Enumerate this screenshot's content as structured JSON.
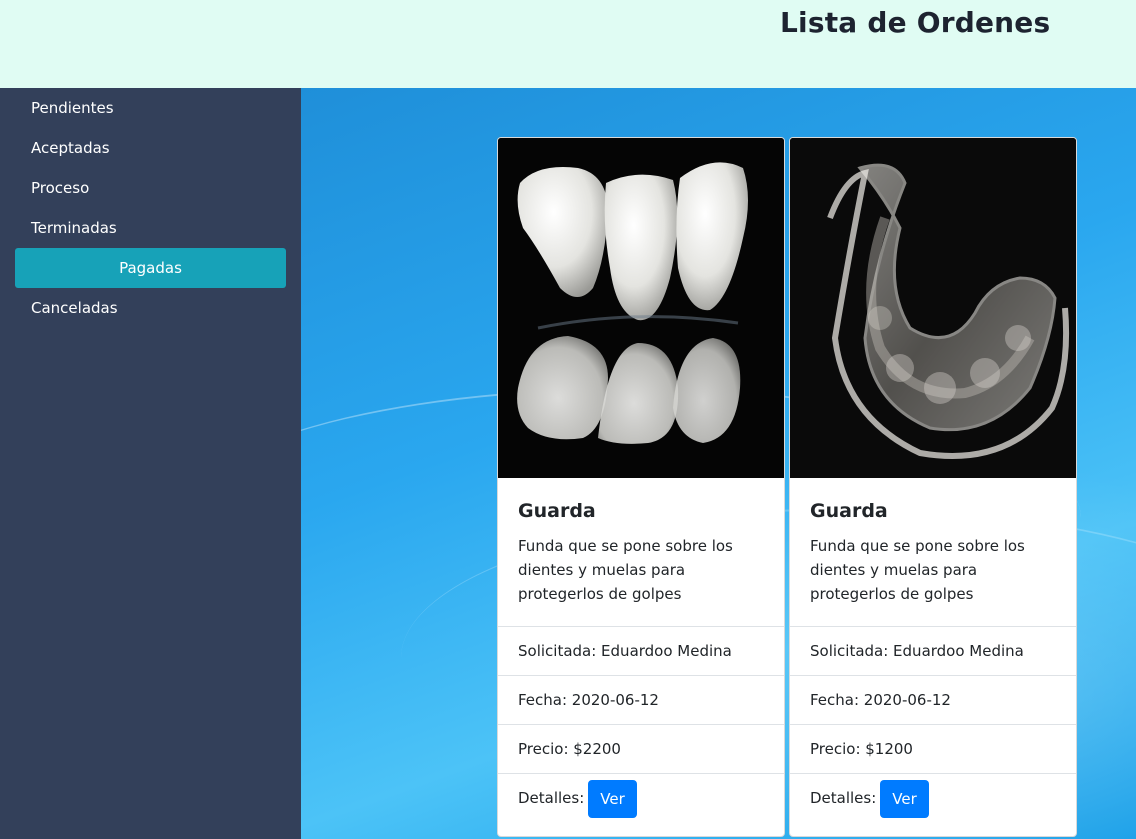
{
  "header": {
    "title": "Lista de Ordenes"
  },
  "sidebar": {
    "items": [
      {
        "label": "Pendientes"
      },
      {
        "label": "Aceptadas"
      },
      {
        "label": "Proceso"
      },
      {
        "label": "Terminadas"
      },
      {
        "label": "Pagadas",
        "active": true
      },
      {
        "label": "Canceladas"
      }
    ]
  },
  "cards": [
    {
      "image": "dental-crown-bridge-photo",
      "title": "Guarda",
      "description": "Funda que se pone sobre los dientes y muelas para protegerlos de golpes",
      "requested_by": "Solicitada: Eduardoo Medina",
      "date": "Fecha: 2020-06-12",
      "price": "Precio: $2200",
      "details_label": "Detalles:",
      "button_label": "Ver"
    },
    {
      "image": "clear-dental-aligner-photo",
      "title": "Guarda",
      "description": "Funda que se pone sobre los dientes y muelas para protegerlos de golpes",
      "requested_by": "Solicitada: Eduardoo Medina",
      "date": "Fecha: 2020-06-12",
      "price": "Precio: $1200",
      "details_label": "Detalles:",
      "button_label": "Ver"
    }
  ],
  "colors": {
    "header_bg": "#e0fcf3",
    "sidebar_bg": "#33405a",
    "active_item": "#17a2b8",
    "button": "#007bff"
  }
}
